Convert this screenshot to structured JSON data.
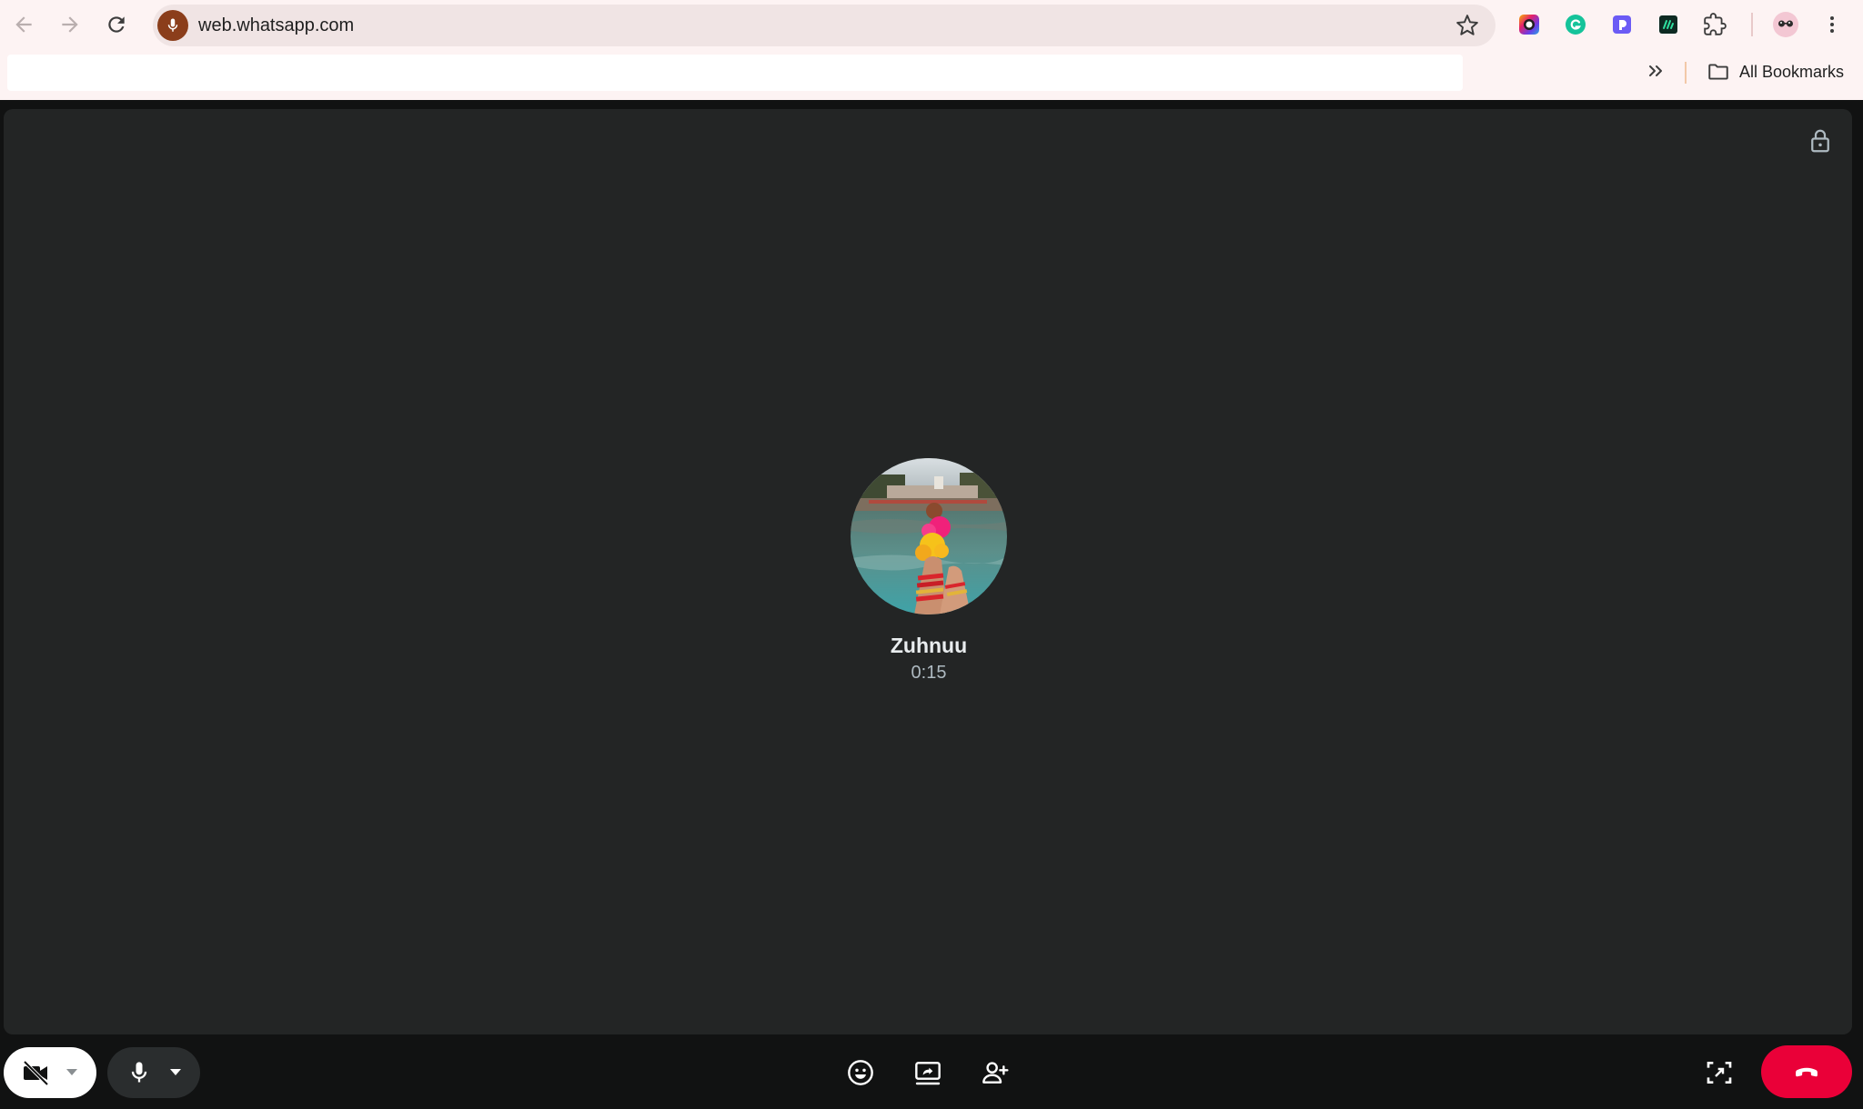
{
  "browser": {
    "url": "web.whatsapp.com",
    "bookmarks_folder_label": "All Bookmarks",
    "icons": {
      "back": "arrow-left-icon",
      "forward": "arrow-right-icon",
      "reload": "reload-icon",
      "mic": "microphone-icon",
      "bookmark": "star-icon",
      "extensions": [
        "colorful-circle-extension-icon",
        "grammarly-extension-icon",
        "purple-extension-icon",
        "dark-green-extension-icon",
        "puzzle-extensions-icon"
      ],
      "profile": "profile-avatar-icon",
      "menu": "kebab-menu-icon"
    },
    "colors": {
      "chrome_bg": "#fdf3f3",
      "omnibox_bg": "#f0e4e4",
      "mic_badge": "#8b3e1b"
    }
  },
  "call": {
    "caller_name": "Zuhnuu",
    "duration": "0:15",
    "encrypted_icon": "lock-icon",
    "colors": {
      "panel_bg": "#232525",
      "bar_bg": "#111212",
      "end_call": "#ea0038"
    }
  },
  "controls": {
    "camera": {
      "icon": "video-off-icon",
      "state": "off"
    },
    "microphone": {
      "icon": "microphone-icon",
      "state": "on"
    },
    "center": [
      "emoji-reaction-icon",
      "screen-share-icon",
      "add-participant-icon"
    ],
    "fullscreen": "fullscreen-icon",
    "end_call": "end-call-icon"
  }
}
